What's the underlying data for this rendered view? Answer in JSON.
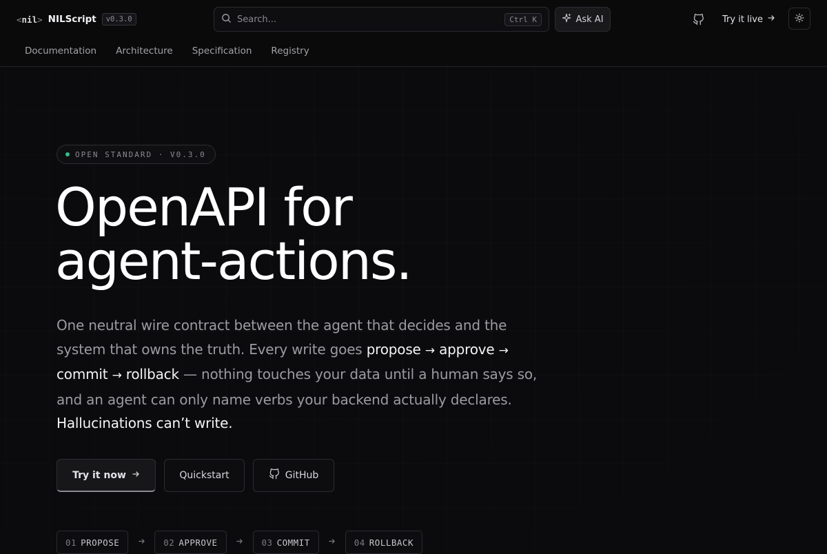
{
  "brand": {
    "open": "<",
    "mark": "nil",
    "close": ">",
    "name": "NILScript",
    "version": "v0.3.0"
  },
  "search": {
    "placeholder": "Search...",
    "shortcut": "Ctrl K"
  },
  "header": {
    "ask_ai": "Ask AI",
    "try_live": "Try it live",
    "github_icon": "github-icon",
    "theme_icon": "sun-icon"
  },
  "nav": {
    "items": [
      {
        "label": "Documentation"
      },
      {
        "label": "Architecture"
      },
      {
        "label": "Specification"
      },
      {
        "label": "Registry"
      }
    ]
  },
  "hero": {
    "badge": "OPEN STANDARD · V0.3.0",
    "title_line1": "OpenAPI for",
    "title_line2": "agent-actions.",
    "lede": {
      "p1": "One neutral wire contract between the agent that decides and the system that owns the truth. Every write goes ",
      "w_propose": "propose",
      "w_approve": "approve",
      "w_commit": "commit",
      "w_rollback": "rollback",
      "arrow": "→",
      "p2": " — nothing touches your data until a human says so, and an agent can only name verbs your backend actually declares. ",
      "p3": "Hallucinations can’t write."
    },
    "buttons": {
      "try_now": "Try it now",
      "quickstart": "Quickstart",
      "github": "GitHub"
    }
  },
  "steps": [
    {
      "num": "01",
      "label": "PROPOSE"
    },
    {
      "num": "02",
      "label": "APPROVE"
    },
    {
      "num": "03",
      "label": "COMMIT"
    },
    {
      "num": "04",
      "label": "ROLLBACK"
    }
  ],
  "colors": {
    "background": "#0b0b0d",
    "accent_dot": "#2fbf8a",
    "text_primary": "#ffffff",
    "text_muted": "#9b9ba1"
  }
}
